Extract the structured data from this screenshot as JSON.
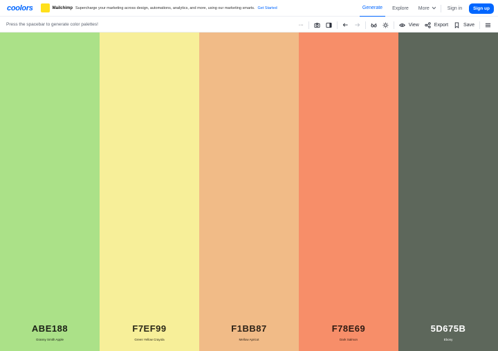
{
  "header": {
    "logo": "coolors",
    "ad": {
      "brand": "Mailchimp",
      "text": "Supercharge your marketing across design, automations, analytics, and more, using our marketing smarts.",
      "cta": "Get Started"
    },
    "nav": {
      "generate": "Generate",
      "explore": "Explore",
      "more": "More",
      "signin": "Sign in",
      "signup": "Sign up"
    }
  },
  "toolbar": {
    "hint": "Press the spacebar to generate color palettes!",
    "more_dots": "···",
    "view": "View",
    "export": "Export",
    "save": "Save"
  },
  "colors": {
    "accent": "#0066ff",
    "mailchimp": "#ffe01b"
  },
  "palette": [
    {
      "hex": "ABE188",
      "name": "Granny Smith Apple",
      "color": "#ABE188",
      "text_color": "#1a1f16"
    },
    {
      "hex": "F7EF99",
      "name": "Green Yellow Crayola",
      "color": "#F7EF99",
      "text_color": "#2a2818"
    },
    {
      "hex": "F1BB87",
      "name": "Mellow Apricot",
      "color": "#F1BB87",
      "text_color": "#2e2318"
    },
    {
      "hex": "F78E69",
      "name": "Dark Salmon",
      "color": "#F78E69",
      "text_color": "#2e1a12"
    },
    {
      "hex": "5D675B",
      "name": "Ebony",
      "color": "#5D675B",
      "text_color": "#ffffff"
    }
  ]
}
